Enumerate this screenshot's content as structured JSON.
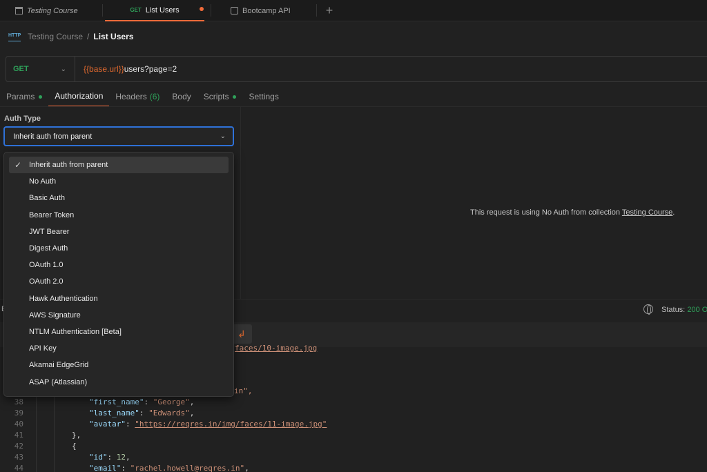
{
  "tabs": [
    {
      "label": "Testing Course"
    },
    {
      "method": "GET",
      "label": "List Users"
    },
    {
      "label": "Bootcamp API"
    }
  ],
  "breadcrumb": {
    "parent": "Testing Course",
    "separator": "/",
    "current": "List Users"
  },
  "request": {
    "method": "GET",
    "url_var": "{{base.url}}",
    "url_rest": "users?page=2"
  },
  "request_tabs": [
    {
      "label": "Params"
    },
    {
      "label": "Authorization"
    },
    {
      "label": "Headers",
      "count": "(6)"
    },
    {
      "label": "Body"
    },
    {
      "label": "Scripts"
    },
    {
      "label": "Settings"
    }
  ],
  "auth": {
    "label": "Auth Type",
    "selected": "Inherit auth from parent",
    "options": [
      "Inherit auth from parent",
      "No Auth",
      "Basic Auth",
      "Bearer Token",
      "JWT Bearer",
      "Digest Auth",
      "OAuth 1.0",
      "OAuth 2.0",
      "Hawk Authentication",
      "AWS Signature",
      "NTLM Authentication [Beta]",
      "API Key",
      "Akamai EdgeGrid",
      "ASAP (Atlassian)"
    ],
    "message_prefix": "This request is using No Auth from collection",
    "message_link": "Testing Course",
    "message_suffix": "."
  },
  "response": {
    "b_letter": "B",
    "status_label": "Status:",
    "status_code": "200 O"
  },
  "code": {
    "line_top_fragment": "faces/10-image.jpg",
    "email_fragment": "in\",",
    "lines": [
      {
        "n": "38",
        "key": "\"first_name\"",
        "value": "\"George\"",
        "trail": ","
      },
      {
        "n": "39",
        "key": "\"last_name\"",
        "value": "\"Edwards\"",
        "trail": ","
      },
      {
        "n": "40",
        "key": "\"avatar\"",
        "value": "\"https://reqres.in/img/faces/11-image.jpg\"",
        "trail": ""
      },
      {
        "n": "41",
        "text": "},"
      },
      {
        "n": "42",
        "text": "{"
      },
      {
        "n": "43",
        "key": "\"id\"",
        "value": "12",
        "trail": ","
      },
      {
        "n": "44",
        "key": "\"email\"",
        "value": "\"rachel.howell@reqres.in\"",
        "trail": ","
      }
    ]
  },
  "colors": {
    "accent": "#f26b3a",
    "get_green": "#2fa15a",
    "focus_blue": "#2f72d9",
    "variable": "#e0692f"
  }
}
